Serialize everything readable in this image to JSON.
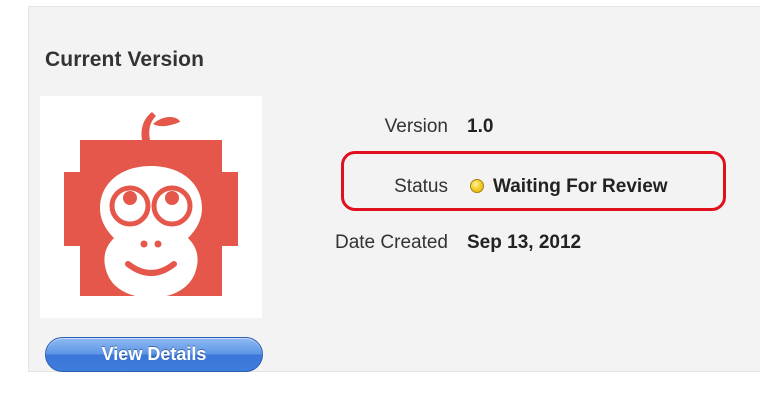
{
  "section": {
    "title": "Current Version"
  },
  "app_icon": {
    "icon": "monkey-face-icon",
    "color": "#e4574a"
  },
  "details": [
    {
      "label": "Version",
      "value": "1.0"
    },
    {
      "label": "Status",
      "value": "Waiting For Review",
      "status_color": "#f4d02a"
    },
    {
      "label": "Date Created",
      "value": "Sep 13, 2012"
    }
  ],
  "actions": {
    "view_details_label": "View Details"
  },
  "highlight": {
    "color": "#e0101f"
  }
}
